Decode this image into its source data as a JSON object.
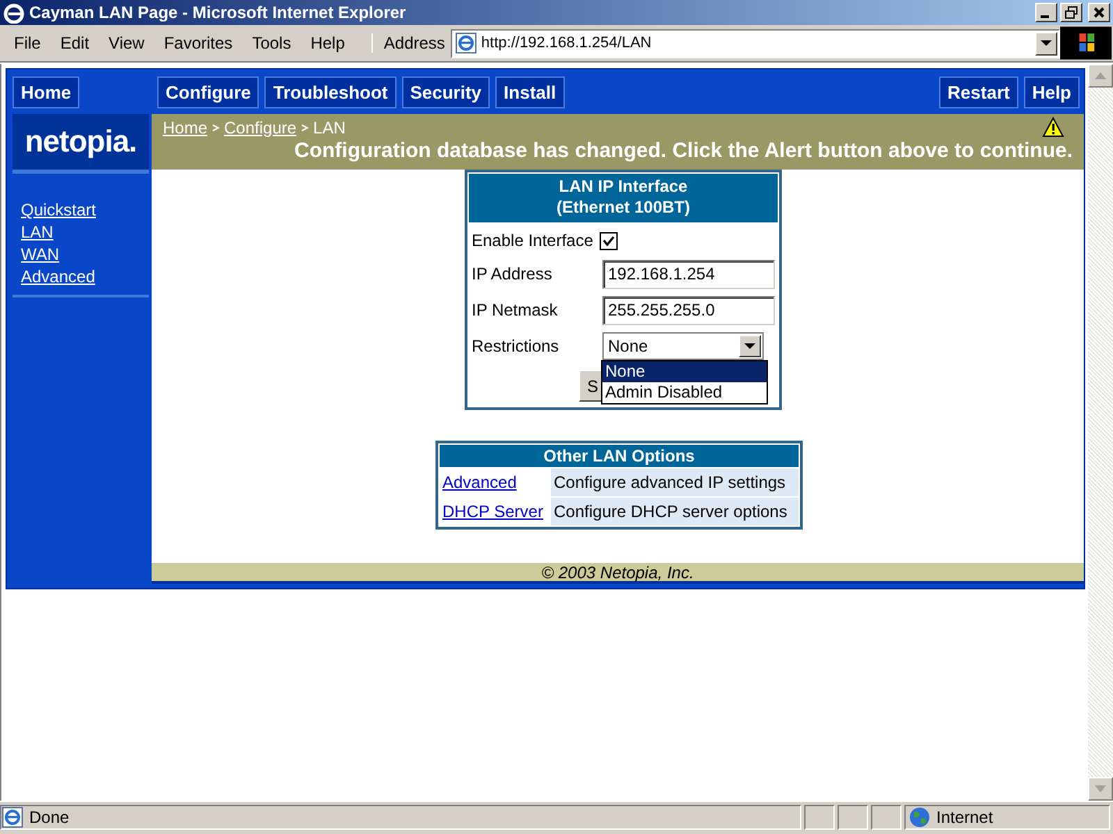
{
  "window": {
    "title": "Cayman LAN Page - Microsoft Internet Explorer"
  },
  "menu": [
    "File",
    "Edit",
    "View",
    "Favorites",
    "Tools",
    "Help"
  ],
  "address": {
    "label": "Address",
    "url": "http://192.168.1.254/LAN"
  },
  "nav": {
    "left": [
      "Home"
    ],
    "main": [
      "Configure",
      "Troubleshoot",
      "Security",
      "Install"
    ],
    "right": [
      "Restart",
      "Help"
    ]
  },
  "logo": "netopia.",
  "sidebar": {
    "items": [
      "Quickstart",
      "LAN",
      "WAN",
      "Advanced"
    ]
  },
  "breadcrumb": [
    {
      "label": "Home",
      "link": true
    },
    {
      "label": "Configure",
      "link": true
    },
    {
      "label": "LAN",
      "link": false
    }
  ],
  "alert": {
    "message": "Configuration database has changed. Click the Alert button above to continue."
  },
  "lan_panel": {
    "title": [
      "LAN IP Interface",
      "(Ethernet 100BT)"
    ],
    "fields": [
      {
        "kind": "checkbox",
        "label": "Enable Interface",
        "checked": true
      },
      {
        "kind": "text",
        "label": "IP Address",
        "value": "192.168.1.254"
      },
      {
        "kind": "text",
        "label": "IP Netmask",
        "value": "255.255.255.0"
      },
      {
        "kind": "select",
        "label": "Restrictions",
        "value": "None",
        "expanded": true,
        "options": [
          {
            "label": "None",
            "selected": true
          },
          {
            "label": "Admin Disabled",
            "selected": false
          }
        ]
      }
    ],
    "submit": "S"
  },
  "other_options": {
    "title": "Other LAN Options",
    "rows": [
      {
        "link": "Advanced",
        "description": "Configure advanced IP settings"
      },
      {
        "link": "DHCP Server",
        "description": "Configure DHCP server options"
      }
    ]
  },
  "footer": "© 2003 Netopia, Inc.",
  "status_bar": {
    "text": "Done",
    "zone": "Internet"
  }
}
